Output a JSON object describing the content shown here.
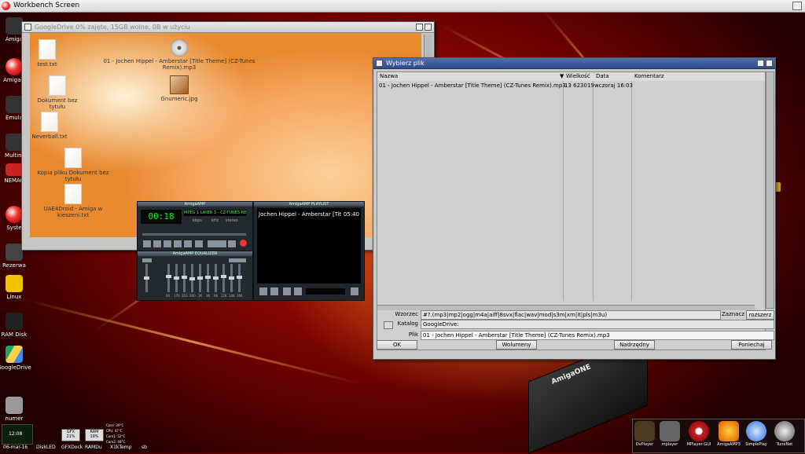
{
  "screen": {
    "title": "Workbench Screen"
  },
  "left_icons": [
    {
      "label": "Amiga"
    },
    {
      "label": "AmigaO"
    },
    {
      "label": "Emula"
    },
    {
      "label": "Multim"
    },
    {
      "label": "NEMAC"
    },
    {
      "label": "Syste"
    },
    {
      "label": "Rezerwa"
    },
    {
      "label": "Linux"
    },
    {
      "label": "RAM Disk"
    },
    {
      "label": "GoogleDrive"
    },
    {
      "label": "numer"
    }
  ],
  "googledrive_window": {
    "title": "GoogleDrive  0% zajęte, 15GB wolne, 0B w użyciu",
    "files": [
      {
        "name": "test.txt",
        "kind": "txt"
      },
      {
        "name": "01 - Jochen Hippel - Amberstar [Title Theme] (CZ-Tunes Remix).mp3",
        "kind": "mp3"
      },
      {
        "name": "Dokument bez tytułu",
        "kind": "doc"
      },
      {
        "name": "Gnumeric.jpg",
        "kind": "jpg"
      },
      {
        "name": "Neverball.txt",
        "kind": "txt"
      },
      {
        "name": "Kopia pliku Dokument bez tytułu",
        "kind": "doc"
      },
      {
        "name": "UAE4Droid - Amiga w kieszeni.txt",
        "kind": "txt"
      }
    ]
  },
  "file_requester": {
    "title": "Wybierz plik",
    "columns": {
      "name": "Nazwa",
      "size": "Wielkość",
      "date": "Data",
      "comment": "Komentarz"
    },
    "rows": [
      {
        "name": "01 - Jochen Hippel - Amberstar [Title Theme] (CZ-Tunes Remix).mp3",
        "size": "13 623019",
        "date": "wczoraj 16:03",
        "comment": ""
      }
    ],
    "pattern_label": "Wzorzec",
    "pattern_value": "#?.(mp3|mp2|ogg|m4a|aiff|8svx|flac|wav|mod|s3m|xm|it|pls|m3u)",
    "select_label": "Zaznacz",
    "expand_button": "rozszerz",
    "drawer_label": "Katalog",
    "drawer_value": "GoogleDrive:",
    "file_label": "Plik",
    "file_value": "01 - Jochen Hippel - Amberstar [Title Theme] (CZ-Tunes Remix).mp3",
    "buttons": {
      "ok": "OK",
      "volumes": "Wolumeny",
      "parent": "Nadrzędny",
      "cancel": "Poniechaj"
    }
  },
  "amigaamp": {
    "title": "AmigaAMP",
    "time": "00:18",
    "ticker": "MPEG 1 LAYER 3 - CZ-TUNES REMIX  05:40",
    "kbps": "kbps",
    "khz": "kHz",
    "stereo": "stereo",
    "eq_title": "AmigaAMP EQUALIZER",
    "eq_freqs": [
      "60",
      "170",
      "310",
      "600",
      "1K",
      "3K",
      "6K",
      "12K",
      "14K",
      "16K"
    ],
    "playlist_title": "AmigaAMP PLAYLIST",
    "playlist_item": "Jochen Hippel - Amberstar [Tit",
    "playlist_time": "05:40"
  },
  "bottom_bar": {
    "clock": "12:08",
    "date": "06-mar-16",
    "labels": [
      "DiskLED",
      "GFXDock",
      "RAMDu",
      "X1kTemp",
      "sb"
    ],
    "gfx": "GFX 21%",
    "ram": "RAM 19%",
    "temps": [
      "Case: 39°C",
      "CPU: 47°C",
      "Core1: 52°C",
      "Core2: 48°C"
    ]
  },
  "dock": [
    {
      "label": "DvPlayer"
    },
    {
      "label": "mplayer"
    },
    {
      "label": "MPlayer-GUI"
    },
    {
      "label": "AmigaAMP3"
    },
    {
      "label": "SimplePlay"
    },
    {
      "label": "TuneNet"
    }
  ],
  "desktop_logo": "AmigaONE",
  "colors": {
    "accent": "#2d4b8a",
    "background": "#8a0400"
  }
}
